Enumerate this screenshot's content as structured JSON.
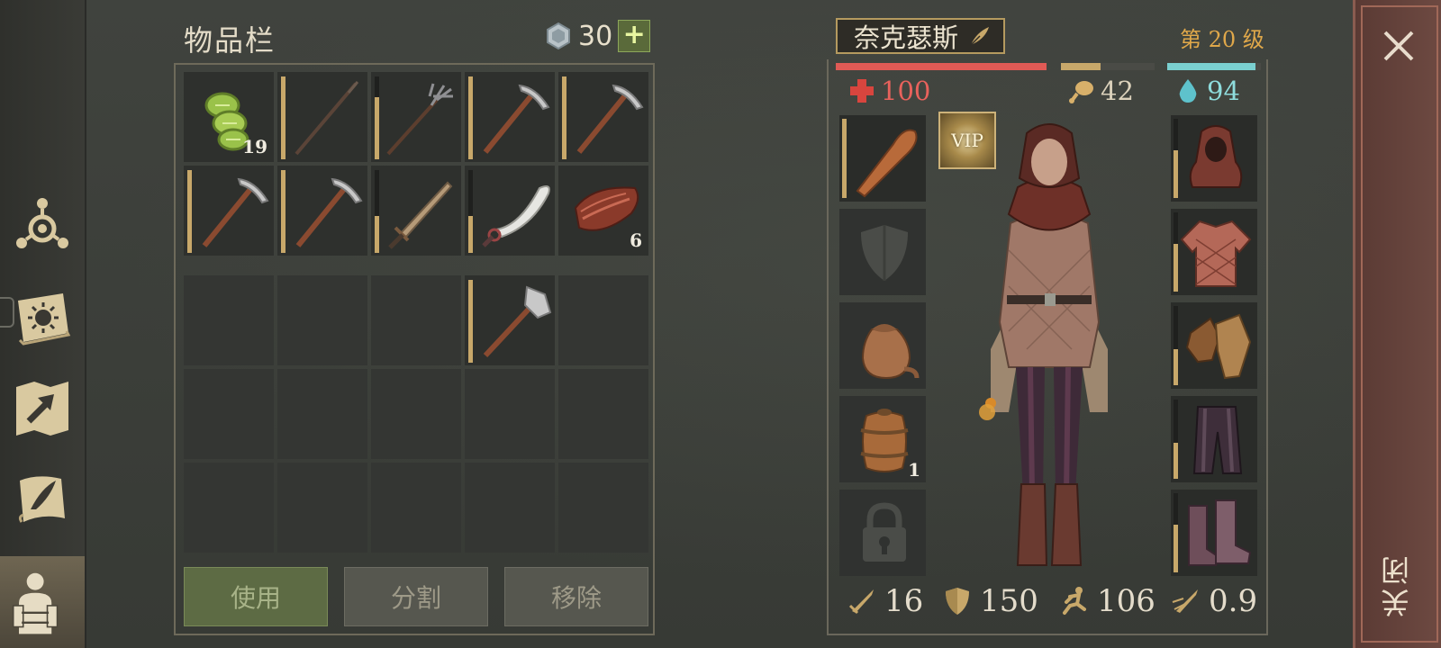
{
  "inventory": {
    "title": "物品栏",
    "currency_amount": "30",
    "plus_label": "+",
    "backpack_slots": [
      {
        "item": "cactus-slices",
        "qty": "19"
      },
      {
        "item": "wooden-spear",
        "durability": 1.0
      },
      {
        "item": "pitchfork",
        "durability": 0.75
      },
      {
        "item": "pickaxe",
        "durability": 1.0
      },
      {
        "item": "pickaxe",
        "durability": 1.0
      },
      {
        "item": "pickaxe",
        "durability": 1.0
      },
      {
        "item": "pickaxe",
        "durability": 1.0
      },
      {
        "item": "short-sword",
        "durability": 0.45
      },
      {
        "item": "scimitar",
        "durability": 0.45
      },
      {
        "item": "raw-meat",
        "qty": "6"
      }
    ],
    "storage_slots": [
      {
        "item": "",
        "empty": true
      },
      {
        "item": "",
        "empty": true
      },
      {
        "item": "",
        "empty": true
      },
      {
        "item": "hammer",
        "durability": 1.0
      },
      {
        "item": "",
        "empty": true
      }
    ],
    "buttons": {
      "use": "使用",
      "split": "分割",
      "remove": "移除"
    }
  },
  "character": {
    "name": "奈克瑟斯",
    "level": "第 20 级",
    "health": "100",
    "hunger": "42",
    "thirst": "94",
    "health_fill": 1.0,
    "hunger_fill": 0.42,
    "thirst_fill": 0.94,
    "vip_label": "VIP",
    "left_equipment": [
      {
        "slot": "weapon",
        "item": "club",
        "durability": 1.0
      },
      {
        "slot": "shield",
        "item": "shield-placeholder"
      },
      {
        "slot": "bag",
        "item": "sack"
      },
      {
        "slot": "consumable",
        "item": "barrel",
        "qty": "1"
      },
      {
        "slot": "locked",
        "item": "lock"
      }
    ],
    "right_equipment": [
      {
        "slot": "head",
        "item": "hood",
        "durability": 0.6
      },
      {
        "slot": "chest",
        "item": "quilted-jacket",
        "durability": 0.6
      },
      {
        "slot": "hands",
        "item": "leather-gloves",
        "durability": 0.45
      },
      {
        "slot": "legs",
        "item": "trousers",
        "durability": 0.45
      },
      {
        "slot": "feet",
        "item": "boots",
        "durability": 0.6
      }
    ],
    "attack": "16",
    "armor": "150",
    "speed": "106",
    "attack_speed": "0.9"
  },
  "close_label": "关闭",
  "colors": {
    "health": "#e05a55",
    "hunger": "#c8a86a",
    "thirst": "#7ad0d0",
    "level": "#e0a84a",
    "durability": "#c8a86a"
  }
}
